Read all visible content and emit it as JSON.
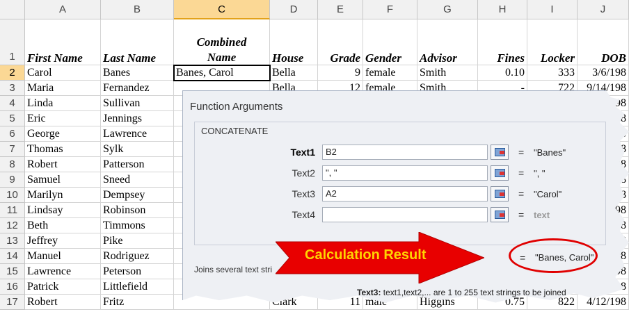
{
  "columns": [
    "A",
    "B",
    "C",
    "D",
    "E",
    "F",
    "G",
    "H",
    "I",
    "J"
  ],
  "headers": {
    "first_name": "First Name",
    "last_name": "Last Name",
    "combined_1": "Combined",
    "combined_2": "Name",
    "house": "House",
    "grade": "Grade",
    "gender": "Gender",
    "advisor": "Advisor",
    "fines": "Fines",
    "locker": "Locker",
    "dob": "DOB"
  },
  "rows": [
    {
      "num": "2",
      "first": "Carol",
      "last": "Banes",
      "combined": "Banes, Carol",
      "house": "Bella",
      "grade": "9",
      "gender": "female",
      "advisor": "Smith",
      "fines": "0.10",
      "locker": "333",
      "dob": "3/6/198"
    },
    {
      "num": "3",
      "first": "Maria",
      "last": "Fernandez",
      "combined": "",
      "house": "Bella",
      "grade": "12",
      "gender": "female",
      "advisor": "Smith",
      "fines": "-",
      "locker": "722",
      "dob": "9/14/198"
    },
    {
      "num": "4",
      "first": "Linda",
      "last": "Sullivan",
      "dob": "198"
    },
    {
      "num": "5",
      "first": "Eric",
      "last": "Jennings",
      "dob": "198"
    },
    {
      "num": "6",
      "first": "George",
      "last": "Lawrence",
      "dob": "198"
    },
    {
      "num": "7",
      "first": "Thomas",
      "last": "Sylk",
      "dob": "198"
    },
    {
      "num": "8",
      "first": "Robert",
      "last": "Patterson",
      "dob": "198"
    },
    {
      "num": "9",
      "first": "Samuel",
      "last": "Sneed",
      "dob": "198"
    },
    {
      "num": "10",
      "first": "Marilyn",
      "last": "Dempsey",
      "dob": "198"
    },
    {
      "num": "11",
      "first": "Lindsay",
      "last": "Robinson",
      "dob": "198"
    },
    {
      "num": "12",
      "first": "Beth",
      "last": "Timmons",
      "dob": "198"
    },
    {
      "num": "13",
      "first": "Jeffrey",
      "last": "Pike",
      "dob": "198"
    },
    {
      "num": "14",
      "first": "Manuel",
      "last": "Rodriguez",
      "dob": "198"
    },
    {
      "num": "15",
      "first": "Lawrence",
      "last": "Peterson",
      "dob": "198"
    },
    {
      "num": "16",
      "first": "Patrick",
      "last": "Littlefield",
      "dob": "5/198"
    },
    {
      "num": "17",
      "first": "Robert",
      "last": "Fritz",
      "house": "Clark",
      "grade": "11",
      "gender": "male",
      "advisor": "Higgins",
      "fines": "0.75",
      "locker": "822",
      "dob": "4/12/198"
    }
  ],
  "row1_num": "1",
  "dialog": {
    "title": "Function Arguments",
    "function_name": "CONCATENATE",
    "args": [
      {
        "label": "Text1",
        "value": "B2",
        "result": "\"Banes\""
      },
      {
        "label": "Text2",
        "value": "\", \"",
        "result": "\", \""
      },
      {
        "label": "Text3",
        "value": "A2",
        "result": "\"Carol\""
      },
      {
        "label": "Text4",
        "value": "",
        "result": "text"
      }
    ],
    "equals": "=",
    "formula_result": "\"Banes, Carol\"",
    "description": "Joins several text stri",
    "help_label": "Text3:",
    "help_text": "text1,text2,... are 1 to 255 text strings to be joined"
  },
  "annotation": {
    "label": "Calculation Result",
    "arrow_color": "#e80000",
    "label_color": "#ffd400"
  }
}
